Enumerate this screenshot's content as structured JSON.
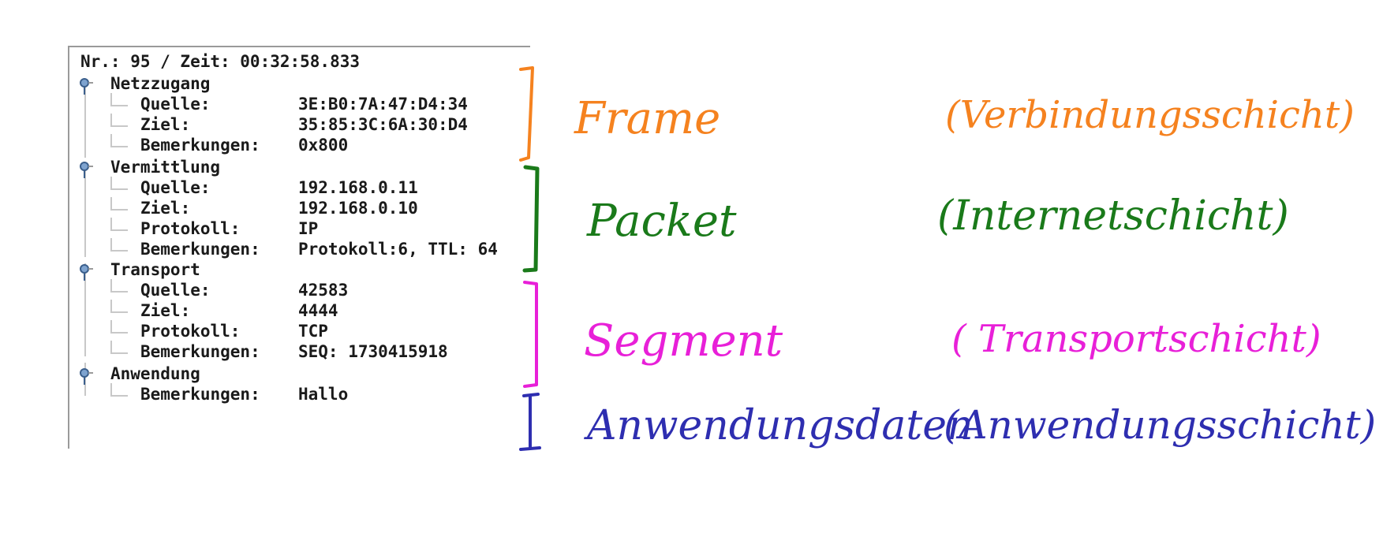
{
  "packet_view": {
    "header": "Nr.: 95 / Zeit: 00:32:58.833",
    "sections": [
      {
        "title": "Netzzugang",
        "rows": [
          {
            "key": "Quelle:",
            "value": "3E:B0:7A:47:D4:34"
          },
          {
            "key": "Ziel:",
            "value": "35:85:3C:6A:30:D4"
          },
          {
            "key": "Bemerkungen:",
            "value": "0x800"
          }
        ]
      },
      {
        "title": "Vermittlung",
        "rows": [
          {
            "key": "Quelle:",
            "value": "192.168.0.11"
          },
          {
            "key": "Ziel:",
            "value": "192.168.0.10"
          },
          {
            "key": "Protokoll:",
            "value": "IP"
          },
          {
            "key": "Bemerkungen:",
            "value": "Protokoll:6, TTL: 64"
          }
        ]
      },
      {
        "title": "Transport",
        "rows": [
          {
            "key": "Quelle:",
            "value": "42583"
          },
          {
            "key": "Ziel:",
            "value": "4444"
          },
          {
            "key": "Protokoll:",
            "value": "TCP"
          },
          {
            "key": "Bemerkungen:",
            "value": "SEQ: 1730415918"
          }
        ]
      },
      {
        "title": "Anwendung",
        "rows": [
          {
            "key": "Bemerkungen:",
            "value": "Hallo"
          }
        ]
      }
    ],
    "node_icon": "tree-node-icon"
  },
  "annotations": [
    {
      "unit": "Frame",
      "layer": "(Verbindungsschicht)",
      "color": "#f5821f"
    },
    {
      "unit": "Packet",
      "layer": "(Internetschicht)",
      "color": "#1a7a1a"
    },
    {
      "unit": "Segment",
      "layer": "( Transportschicht)",
      "color": "#e820d8"
    },
    {
      "unit": "Anwendungsdaten",
      "layer": "(Anwendungsschicht)",
      "color": "#2e2eb0"
    }
  ]
}
